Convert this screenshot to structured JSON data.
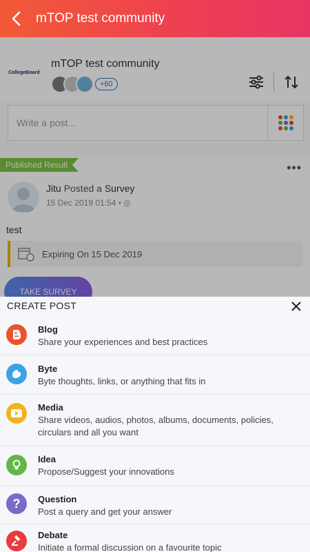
{
  "appbar": {
    "title": "mTOP test community"
  },
  "community": {
    "logo_text": "CollegeBoard",
    "name": "mTOP test community",
    "more_members": "+60"
  },
  "composer": {
    "placeholder": "Write a post..."
  },
  "post": {
    "badge": "Published Result",
    "author": "Jitu",
    "action": "Posted a",
    "type": "Survey",
    "date": "15 Dec 2019 01:54",
    "text": "test",
    "expiry": "Expiring On 15 Dec 2019",
    "cta": "TAKE SURVEY"
  },
  "sheet": {
    "title": "CREATE POST",
    "options": [
      {
        "title": "Blog",
        "desc": "Share your experiences and best practices",
        "icon": "blogger-icon",
        "color": "#e9532d"
      },
      {
        "title": "Byte",
        "desc": "Byte thoughts, links, or anything that fits in",
        "icon": "byte-icon",
        "color": "#3aa3e3"
      },
      {
        "title": "Media",
        "desc": "Share videos, audios, photos, albums, documents, policies, circulars and all you want",
        "icon": "play-icon",
        "color": "#f2b21b"
      },
      {
        "title": "Idea",
        "desc": "Propose/Suggest your innovations",
        "icon": "bulb-icon",
        "color": "#62b847"
      },
      {
        "title": "Question",
        "desc": "Post a query and get your answer",
        "icon": "question-icon",
        "color": "#7b6ac8"
      },
      {
        "title": "Debate",
        "desc": "Initiate a formal discussion on a favourite topic",
        "icon": "gavel-icon",
        "color": "#e83b3b"
      }
    ]
  }
}
